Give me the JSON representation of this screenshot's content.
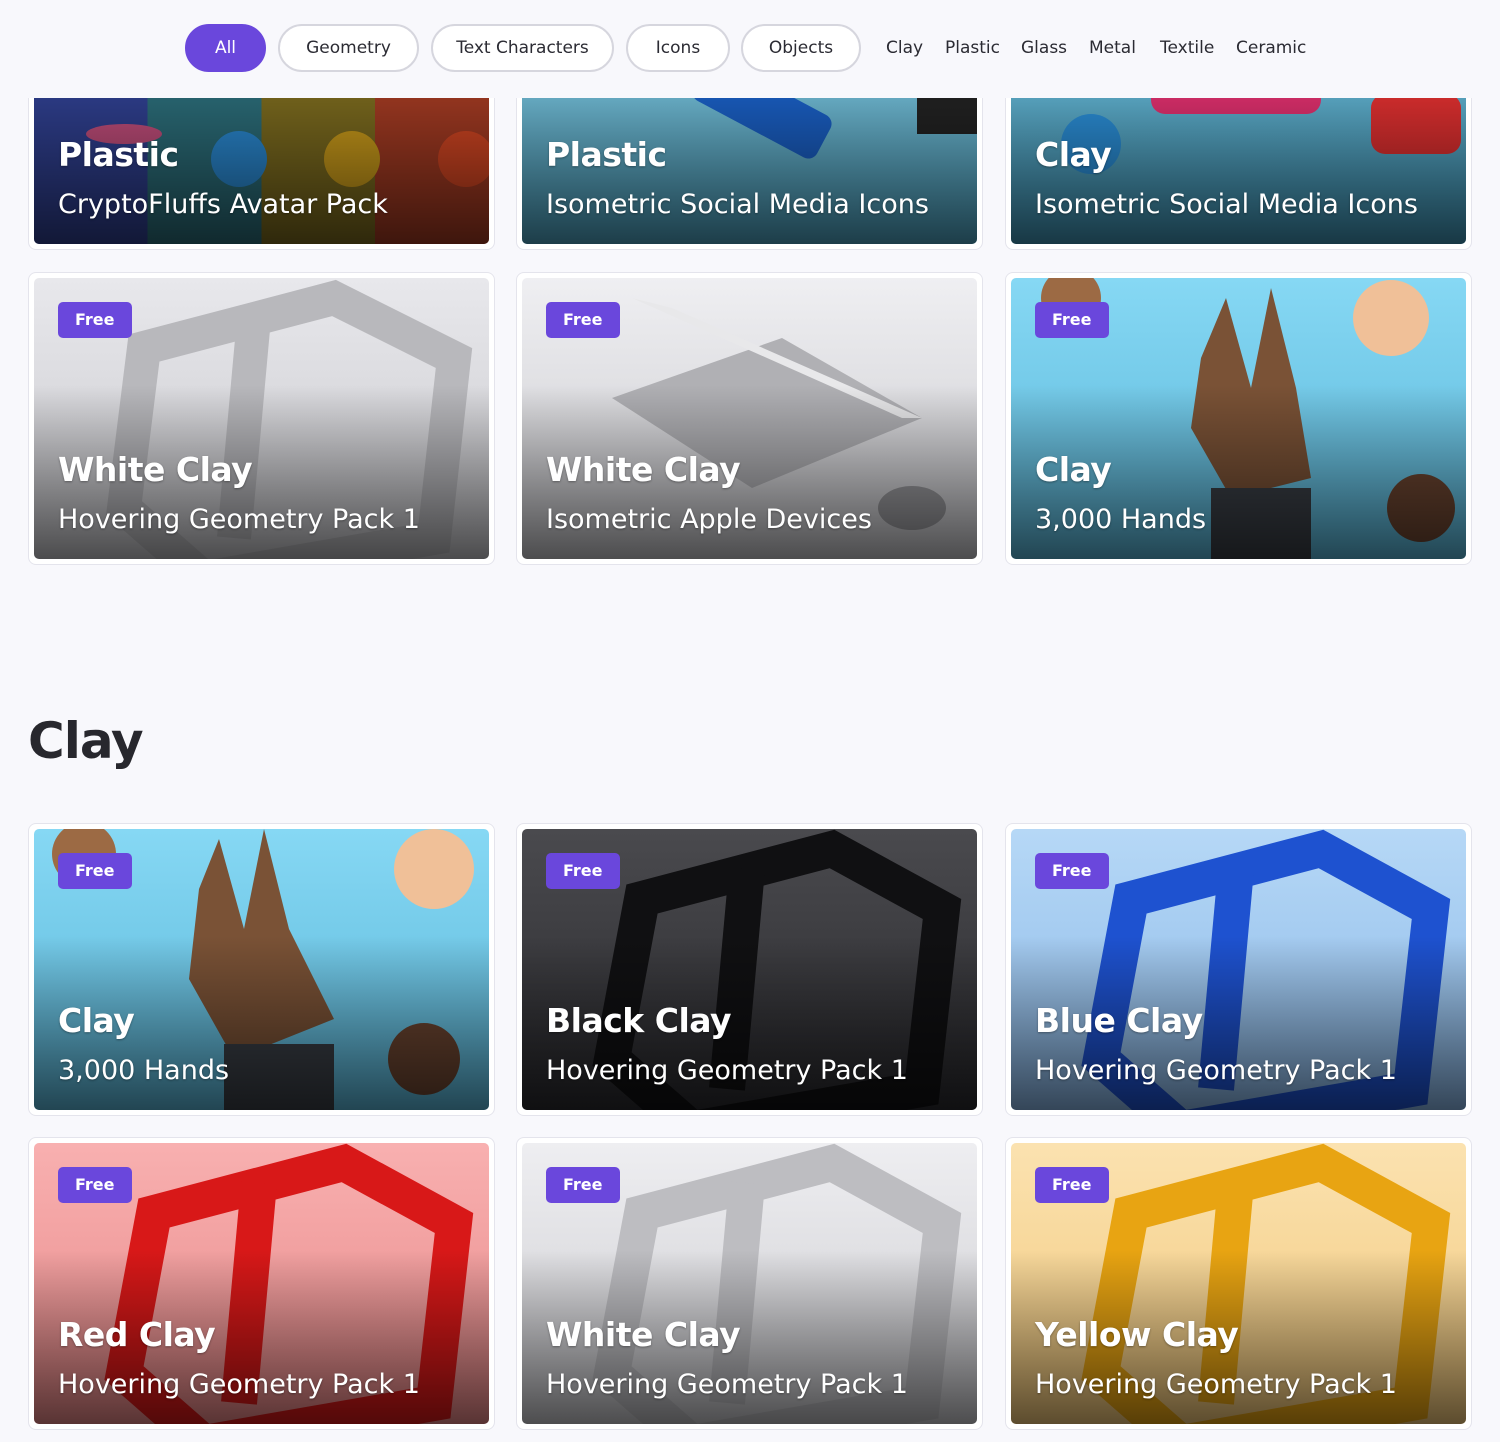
{
  "filters": {
    "pills": [
      {
        "label": "All",
        "active": true
      },
      {
        "label": "Geometry"
      },
      {
        "label": "Text Characters"
      },
      {
        "label": "Icons"
      },
      {
        "label": "Objects"
      }
    ],
    "links": [
      "Clay",
      "Plastic",
      "Glass",
      "Metal",
      "Textile",
      "Ceramic"
    ]
  },
  "top_row": [
    {
      "title": "Plastic",
      "subtitle": "CryptoFluffs Avatar Pack"
    },
    {
      "title": "Plastic",
      "subtitle": "Isometric Social Media Icons"
    },
    {
      "title": "Clay",
      "subtitle": "Isometric Social Media Icons"
    }
  ],
  "row2": [
    {
      "badge": "Free",
      "title": "White Clay",
      "subtitle": "Hovering Geometry Pack 1"
    },
    {
      "badge": "Free",
      "title": "White Clay",
      "subtitle": "Isometric Apple Devices"
    },
    {
      "badge": "Free",
      "title": "Clay",
      "subtitle": "3,000 Hands"
    }
  ],
  "section": {
    "title": "Clay"
  },
  "clay_cards": [
    {
      "badge": "Free",
      "title": "Clay",
      "subtitle": "3,000 Hands"
    },
    {
      "badge": "Free",
      "title": "Black Clay",
      "subtitle": "Hovering Geometry Pack 1"
    },
    {
      "badge": "Free",
      "title": "Blue Clay",
      "subtitle": "Hovering Geometry Pack 1"
    },
    {
      "badge": "Free",
      "title": "Red Clay",
      "subtitle": "Hovering Geometry Pack 1"
    },
    {
      "badge": "Free",
      "title": "White Clay",
      "subtitle": "Hovering Geometry Pack 1"
    },
    {
      "badge": "Free",
      "title": "Yellow Clay",
      "subtitle": "Hovering Geometry Pack 1"
    }
  ],
  "colors": {
    "accent": "#6a47dc",
    "white_clay_bg": "#dcdce0",
    "black_clay_bg": "#3a3a3e",
    "blue_clay_bg": "#a9cef0",
    "red_clay_bg": "#f5a0a0",
    "yellow_clay_bg": "#f8dca0",
    "hands_bg": "#7fd4f0"
  }
}
